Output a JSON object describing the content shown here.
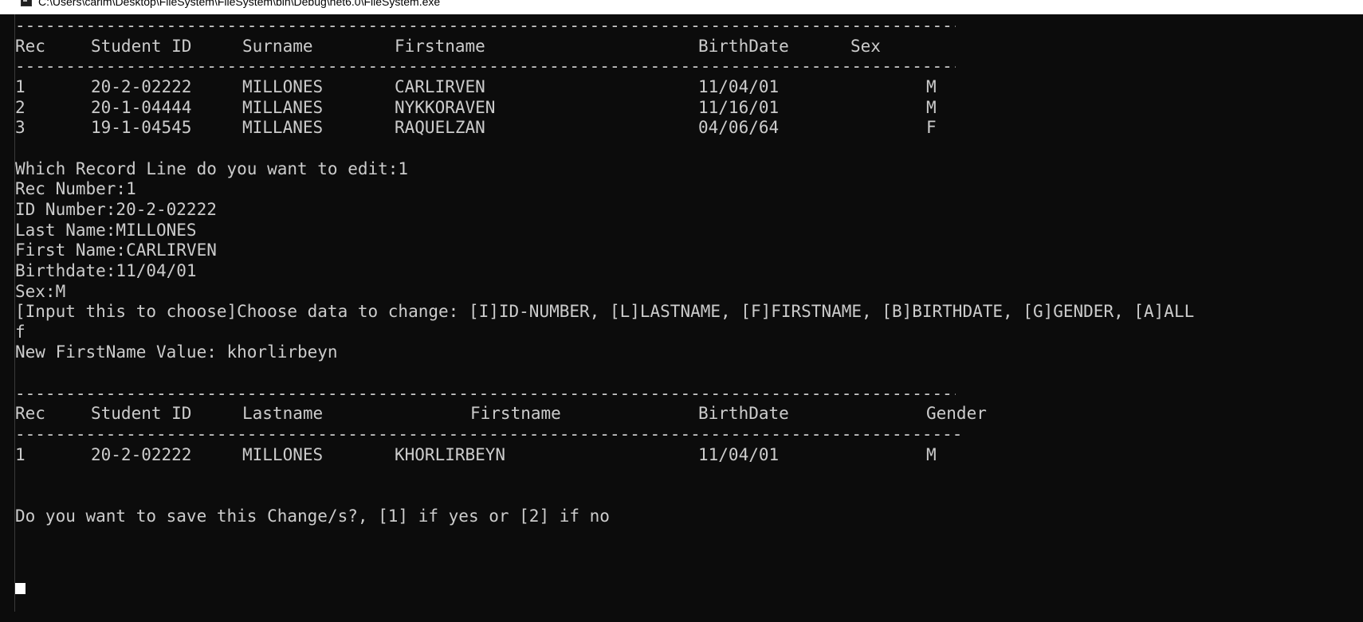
{
  "window": {
    "title": "C:\\Users\\carim\\Desktop\\FileSystem\\FileSystem\\bin\\Debug\\net6.0\\FileSystem.exe"
  },
  "table1": {
    "separator": "-------------------------------------------------------------------------------------------------------",
    "headers": [
      "Rec",
      "Student ID",
      "Surname",
      "Firstname",
      "BirthDate",
      "Sex"
    ],
    "rows": [
      [
        "1",
        "20-2-02222",
        "MILLONES",
        "CARLIRVEN",
        "11/04/01",
        "M"
      ],
      [
        "2",
        "20-1-04444",
        "MILLANES",
        "NYKKORAVEN",
        "11/16/01",
        "M"
      ],
      [
        "3",
        "19-1-04545",
        "MILLANES",
        "RAQUELZAN",
        "04/06/64",
        "F"
      ]
    ]
  },
  "prompts": {
    "which_record": "Which Record Line do you want to edit:1",
    "rec_number": "Rec Number:1",
    "id_number": "ID Number:20-2-02222",
    "last_name": "Last Name:MILLONES",
    "first_name": "First Name:CARLIRVEN",
    "birthdate": "Birthdate:11/04/01",
    "sex": "Sex:M",
    "choose_data": "[Input this to choose]Choose data to change: [I]ID-NUMBER, [L]LASTNAME, [F]FIRSTNAME, [B]BIRTHDATE, [G]GENDER, [A]ALL",
    "choice_input": "f",
    "new_value": "New FirstName Value: khorlirbeyn"
  },
  "table2": {
    "separator_top": "-------------------------------------------------------------------------------------------------------",
    "separator_bottom": "--------------------------------------------------------------------------------------------------------",
    "headers": [
      "Rec",
      "Student ID",
      "Lastname",
      "Firstname",
      "BirthDate",
      "Gender"
    ],
    "rows": [
      [
        "1",
        "20-2-02222",
        "MILLONES",
        "KHORLIRBEYN",
        "11/04/01",
        "M"
      ]
    ]
  },
  "save_prompt": "Do you want to save this Change/s?, [1] if yes or [2] if no"
}
